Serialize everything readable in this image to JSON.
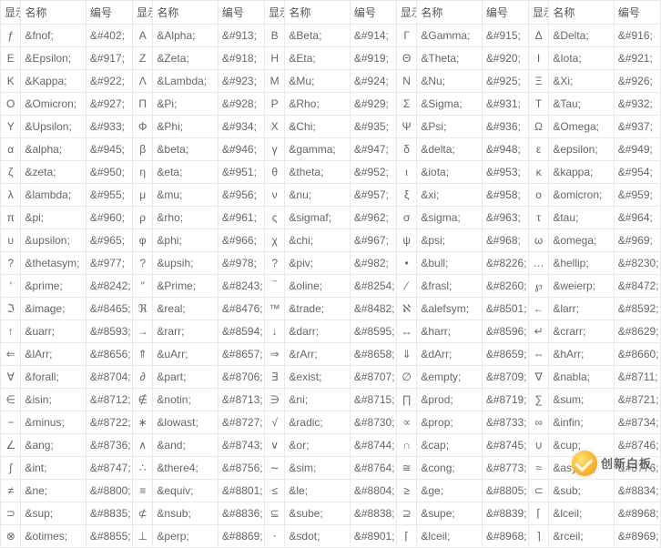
{
  "headers": {
    "display": "显示",
    "name": "名称",
    "code": "编号"
  },
  "groups": 5,
  "rows": [
    [
      [
        "ƒ",
        "&fnof;",
        "&#402;"
      ],
      [
        "Α",
        "&Alpha;",
        "&#913;"
      ],
      [
        "Β",
        "&Beta;",
        "&#914;"
      ],
      [
        "Γ",
        "&Gamma;",
        "&#915;"
      ],
      [
        "Δ",
        "&Delta;",
        "&#916;"
      ]
    ],
    [
      [
        "Ε",
        "&Epsilon;",
        "&#917;"
      ],
      [
        "Ζ",
        "&Zeta;",
        "&#918;"
      ],
      [
        "Η",
        "&Eta;",
        "&#919;"
      ],
      [
        "Θ",
        "&Theta;",
        "&#920;"
      ],
      [
        "Ι",
        "&Iota;",
        "&#921;"
      ]
    ],
    [
      [
        "Κ",
        "&Kappa;",
        "&#922;"
      ],
      [
        "Λ",
        "&Lambda;",
        "&#923;"
      ],
      [
        "Μ",
        "&Mu;",
        "&#924;"
      ],
      [
        "Ν",
        "&Nu;",
        "&#925;"
      ],
      [
        "Ξ",
        "&Xi;",
        "&#926;"
      ]
    ],
    [
      [
        "Ο",
        "&Omicron;",
        "&#927;"
      ],
      [
        "Π",
        "&Pi;",
        "&#928;"
      ],
      [
        "Ρ",
        "&Rho;",
        "&#929;"
      ],
      [
        "Σ",
        "&Sigma;",
        "&#931;"
      ],
      [
        "Τ",
        "&Tau;",
        "&#932;"
      ]
    ],
    [
      [
        "Υ",
        "&Upsilon;",
        "&#933;"
      ],
      [
        "Φ",
        "&Phi;",
        "&#934;"
      ],
      [
        "Χ",
        "&Chi;",
        "&#935;"
      ],
      [
        "Ψ",
        "&Psi;",
        "&#936;"
      ],
      [
        "Ω",
        "&Omega;",
        "&#937;"
      ]
    ],
    [
      [
        "α",
        "&alpha;",
        "&#945;"
      ],
      [
        "β",
        "&beta;",
        "&#946;"
      ],
      [
        "γ",
        "&gamma;",
        "&#947;"
      ],
      [
        "δ",
        "&delta;",
        "&#948;"
      ],
      [
        "ε",
        "&epsilon;",
        "&#949;"
      ]
    ],
    [
      [
        "ζ",
        "&zeta;",
        "&#950;"
      ],
      [
        "η",
        "&eta;",
        "&#951;"
      ],
      [
        "θ",
        "&theta;",
        "&#952;"
      ],
      [
        "ι",
        "&iota;",
        "&#953;"
      ],
      [
        "κ",
        "&kappa;",
        "&#954;"
      ]
    ],
    [
      [
        "λ",
        "&lambda;",
        "&#955;"
      ],
      [
        "μ",
        "&mu;",
        "&#956;"
      ],
      [
        "ν",
        "&nu;",
        "&#957;"
      ],
      [
        "ξ",
        "&xi;",
        "&#958;"
      ],
      [
        "ο",
        "&omicron;",
        "&#959;"
      ]
    ],
    [
      [
        "π",
        "&pi;",
        "&#960;"
      ],
      [
        "ρ",
        "&rho;",
        "&#961;"
      ],
      [
        "ς",
        "&sigmaf;",
        "&#962;"
      ],
      [
        "σ",
        "&sigma;",
        "&#963;"
      ],
      [
        "τ",
        "&tau;",
        "&#964;"
      ]
    ],
    [
      [
        "υ",
        "&upsilon;",
        "&#965;"
      ],
      [
        "φ",
        "&phi;",
        "&#966;"
      ],
      [
        "χ",
        "&chi;",
        "&#967;"
      ],
      [
        "ψ",
        "&psi;",
        "&#968;"
      ],
      [
        "ω",
        "&omega;",
        "&#969;"
      ]
    ],
    [
      [
        "?",
        "&thetasym;",
        "&#977;"
      ],
      [
        "?",
        "&upsih;",
        "&#978;"
      ],
      [
        "?",
        "&piv;",
        "&#982;"
      ],
      [
        "•",
        "&bull;",
        "&#8226;"
      ],
      [
        "…",
        "&hellip;",
        "&#8230;"
      ]
    ],
    [
      [
        "′",
        "&prime;",
        "&#8242;"
      ],
      [
        "″",
        "&Prime;",
        "&#8243;"
      ],
      [
        "‾",
        "&oline;",
        "&#8254;"
      ],
      [
        "⁄",
        "&frasl;",
        "&#8260;"
      ],
      [
        "℘",
        "&weierp;",
        "&#8472;"
      ]
    ],
    [
      [
        "ℑ",
        "&image;",
        "&#8465;"
      ],
      [
        "ℜ",
        "&real;",
        "&#8476;"
      ],
      [
        "™",
        "&trade;",
        "&#8482;"
      ],
      [
        "ℵ",
        "&alefsym;",
        "&#8501;"
      ],
      [
        "←",
        "&larr;",
        "&#8592;"
      ]
    ],
    [
      [
        "↑",
        "&uarr;",
        "&#8593;"
      ],
      [
        "→",
        "&rarr;",
        "&#8594;"
      ],
      [
        "↓",
        "&darr;",
        "&#8595;"
      ],
      [
        "↔",
        "&harr;",
        "&#8596;"
      ],
      [
        "↵",
        "&crarr;",
        "&#8629;"
      ]
    ],
    [
      [
        "⇐",
        "&lArr;",
        "&#8656;"
      ],
      [
        "⇑",
        "&uArr;",
        "&#8657;"
      ],
      [
        "⇒",
        "&rArr;",
        "&#8658;"
      ],
      [
        "⇓",
        "&dArr;",
        "&#8659;"
      ],
      [
        "⇔",
        "&hArr;",
        "&#8660;"
      ]
    ],
    [
      [
        "∀",
        "&forall;",
        "&#8704;"
      ],
      [
        "∂",
        "&part;",
        "&#8706;"
      ],
      [
        "∃",
        "&exist;",
        "&#8707;"
      ],
      [
        "∅",
        "&empty;",
        "&#8709;"
      ],
      [
        "∇",
        "&nabla;",
        "&#8711;"
      ]
    ],
    [
      [
        "∈",
        "&isin;",
        "&#8712;"
      ],
      [
        "∉",
        "&notin;",
        "&#8713;"
      ],
      [
        "∋",
        "&ni;",
        "&#8715;"
      ],
      [
        "∏",
        "&prod;",
        "&#8719;"
      ],
      [
        "∑",
        "&sum;",
        "&#8721;"
      ]
    ],
    [
      [
        "−",
        "&minus;",
        "&#8722;"
      ],
      [
        "∗",
        "&lowast;",
        "&#8727;"
      ],
      [
        "√",
        "&radic;",
        "&#8730;"
      ],
      [
        "∝",
        "&prop;",
        "&#8733;"
      ],
      [
        "∞",
        "&infin;",
        "&#8734;"
      ]
    ],
    [
      [
        "∠",
        "&ang;",
        "&#8736;"
      ],
      [
        "∧",
        "&and;",
        "&#8743;"
      ],
      [
        "∨",
        "&or;",
        "&#8744;"
      ],
      [
        "∩",
        "&cap;",
        "&#8745;"
      ],
      [
        "∪",
        "&cup;",
        "&#8746;"
      ]
    ],
    [
      [
        "∫",
        "&int;",
        "&#8747;"
      ],
      [
        "∴",
        "&there4;",
        "&#8756;"
      ],
      [
        "∼",
        "&sim;",
        "&#8764;"
      ],
      [
        "≅",
        "&cong;",
        "&#8773;"
      ],
      [
        "≈",
        "&asymp;",
        "&#8776;"
      ]
    ],
    [
      [
        "≠",
        "&ne;",
        "&#8800;"
      ],
      [
        "≡",
        "&equiv;",
        "&#8801;"
      ],
      [
        "≤",
        "&le;",
        "&#8804;"
      ],
      [
        "≥",
        "&ge;",
        "&#8805;"
      ],
      [
        "⊂",
        "&sub;",
        "&#8834;"
      ]
    ],
    [
      [
        "⊃",
        "&sup;",
        "&#8835;"
      ],
      [
        "⊄",
        "&nsub;",
        "&#8836;"
      ],
      [
        "⊆",
        "&sube;",
        "&#8838;"
      ],
      [
        "⊇",
        "&supe;",
        "&#8839;"
      ],
      [
        "⌈",
        "&lceil;",
        "&#8968;"
      ]
    ],
    [
      [
        "⊗",
        "&otimes;",
        "&#8855;"
      ],
      [
        "⊥",
        "&perp;",
        "&#8869;"
      ],
      [
        "⋅",
        "&sdot;",
        "&#8901;"
      ],
      [
        "⌈",
        "&lceil;",
        "&#8968;"
      ],
      [
        "⌉",
        "&rceil;",
        "&#8969;"
      ]
    ]
  ],
  "watermark": "创新白板"
}
